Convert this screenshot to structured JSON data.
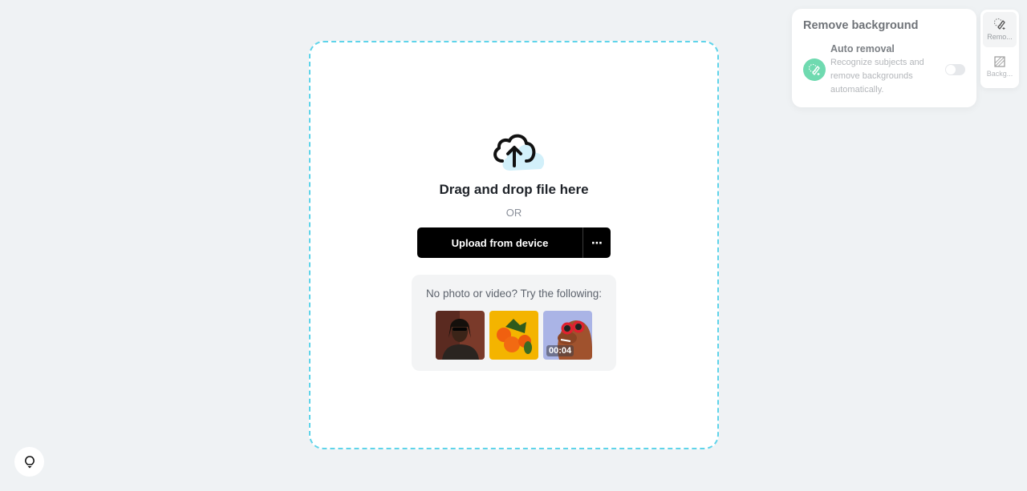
{
  "upload": {
    "title": "Drag and drop file here",
    "or": "OR",
    "upload_button": "Upload from device",
    "more_button": "⋯",
    "samples_label": "No photo or video? Try the following:",
    "samples": [
      {
        "kind": "photo",
        "subject": "person with sunglasses"
      },
      {
        "kind": "photo",
        "subject": "oranges on yellow"
      },
      {
        "kind": "video",
        "subject": "dog with red sunglasses",
        "duration": "00:04"
      }
    ]
  },
  "panel": {
    "title": "Remove background",
    "auto_removal": {
      "title": "Auto removal",
      "description": "Recognize subjects and remove backgrounds automatically.",
      "enabled": false
    }
  },
  "side_rail": {
    "items": [
      {
        "label": "Remo...",
        "icon": "magic-eraser-icon",
        "active": true
      },
      {
        "label": "Backg...",
        "icon": "background-icon",
        "active": false
      }
    ]
  },
  "colors": {
    "accent_dashed": "#5fd4ea",
    "auto_icon_bg": "#6fdab0",
    "button_bg": "#000000"
  }
}
